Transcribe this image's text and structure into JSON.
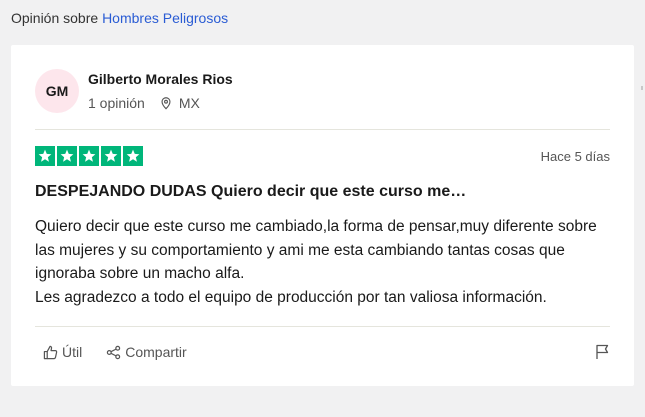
{
  "breadcrumb": {
    "prefix": "Opinión sobre",
    "company": "Hombres Peligrosos"
  },
  "review": {
    "author": {
      "initials": "GM",
      "name": "Gilberto Morales Rios",
      "reviews_count": "1 opinión",
      "country": "MX"
    },
    "rating": 5,
    "rating_max": 5,
    "date": "Hace 5 días",
    "title": "DESPEJANDO DUDAS Quiero decir que este curso me…",
    "body_lines": [
      "Quiero decir que este curso me cambiado,la forma de pensar,muy diferente sobre las mujeres y su comportamiento y ami me esta cambiando tantas cosas que ignoraba sobre un macho alfa.",
      "Les agradezco a todo el equipo de producción por tan valiosa información."
    ]
  },
  "actions": {
    "useful_label": "Útil",
    "share_label": "Compartir"
  },
  "colors": {
    "star_green": "#00b67a",
    "link_blue": "#2a5cd4",
    "avatar_bg": "#fde6ec"
  },
  "icons": [
    "location-pin-icon",
    "star-icon",
    "thumbs-up-icon",
    "share-icon",
    "flag-icon"
  ]
}
